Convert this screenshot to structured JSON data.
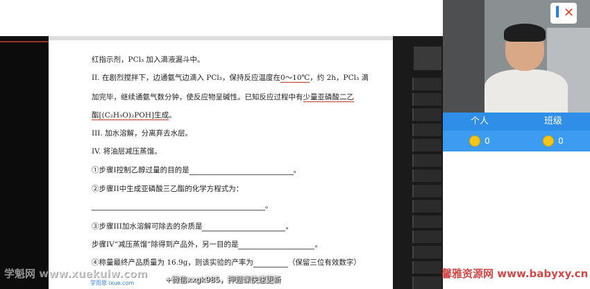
{
  "document": {
    "line1": "红指示剂，PCl₃ 加入滴液漏斗中。",
    "line2_a": "II. 在剧烈搅拌下，边通氨气边滴入 PCl₃，保持反应温度在",
    "line2_temp": "0～10℃",
    "line2_b": "，约 2h，PCl₃ 滴",
    "line3_a": "加完毕，继续通氨气数分钟，使反应物呈碱性。已知反应过程中有",
    "line3_b": "少量亚磷酸二乙",
    "line4_a": "酯[(C₂H₅O)₂POH]生成",
    "line4_b": "。",
    "line5": "III. 加水溶解，分离弃去水层。",
    "line6": "IV. 将油层减压蒸馏。",
    "q1": "①步骤I控制乙醇过量的目的是",
    "q1_end": "。",
    "q2": "②步骤II中生成亚磷酸三乙酯的化学方程式为：",
    "q2_end": "。",
    "q3": "③步骤III加水溶解可除去的杂质是",
    "q3_end": "。",
    "q4": "步骤IV“减压蒸馏”除得到产品外，另一目的是",
    "q4_end": "。",
    "q5_a": "④称量最终产品质量为 16.9g，则该实验的产率为",
    "q5_b": "（保留三位有效数字）"
  },
  "video": {
    "logo": "I"
  },
  "score_tabs": [
    "个人",
    "班级"
  ],
  "scores": [
    "0",
    "0"
  ],
  "watermark_left": "学魁网 www.xuekuiw.com",
  "watermark_right": "馨雅资源网 www.babyxy.cn",
  "subtitle": "+微信xxgk985，押题课快速更新",
  "doc_logo": "学而思 ixue.com"
}
